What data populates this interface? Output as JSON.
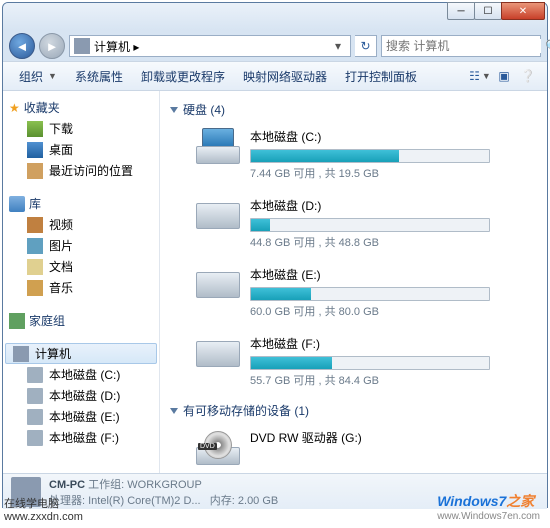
{
  "address": {
    "path": "计算机 ▸",
    "search_placeholder": "搜索 计算机"
  },
  "toolbar": {
    "organize": "组织",
    "props": "系统属性",
    "uninstall": "卸载或更改程序",
    "map": "映射网络驱动器",
    "cpanel": "打开控制面板"
  },
  "sidebar": {
    "fav": "收藏夹",
    "fav_items": [
      "下载",
      "桌面",
      "最近访问的位置"
    ],
    "lib": "库",
    "lib_items": [
      "视频",
      "图片",
      "文档",
      "音乐"
    ],
    "homegroup": "家庭组",
    "computer": "计算机",
    "drives": [
      "本地磁盘 (C:)",
      "本地磁盘 (D:)",
      "本地磁盘 (E:)",
      "本地磁盘 (F:)"
    ]
  },
  "main": {
    "hdd_group": "硬盘 (4)",
    "removable_group": "有可移动存储的设备 (1)",
    "drives": [
      {
        "name": "本地磁盘 (C:)",
        "stat": "7.44 GB 可用 , 共 19.5 GB",
        "used": 62
      },
      {
        "name": "本地磁盘 (D:)",
        "stat": "44.8 GB 可用 , 共 48.8 GB",
        "used": 8
      },
      {
        "name": "本地磁盘 (E:)",
        "stat": "60.0 GB 可用 , 共 80.0 GB",
        "used": 25
      },
      {
        "name": "本地磁盘 (F:)",
        "stat": "55.7 GB 可用 , 共 84.4 GB",
        "used": 34
      }
    ],
    "dvd": {
      "name": "DVD RW 驱动器 (G:)",
      "badge": "DVD"
    }
  },
  "status": {
    "name": "CM-PC",
    "wg_label": "工作组:",
    "wg": "WORKGROUP",
    "cpu_label": "处理器:",
    "cpu": "Intel(R) Core(TM)2 D...",
    "mem_label": "内存:",
    "mem": "2.00 GB"
  },
  "watermark": {
    "left1": "在线学电脑",
    "left2": "www.zxxdn.com",
    "r1": "Windows7",
    "r2": "之家",
    "r3": "www.Windows7en.com"
  }
}
